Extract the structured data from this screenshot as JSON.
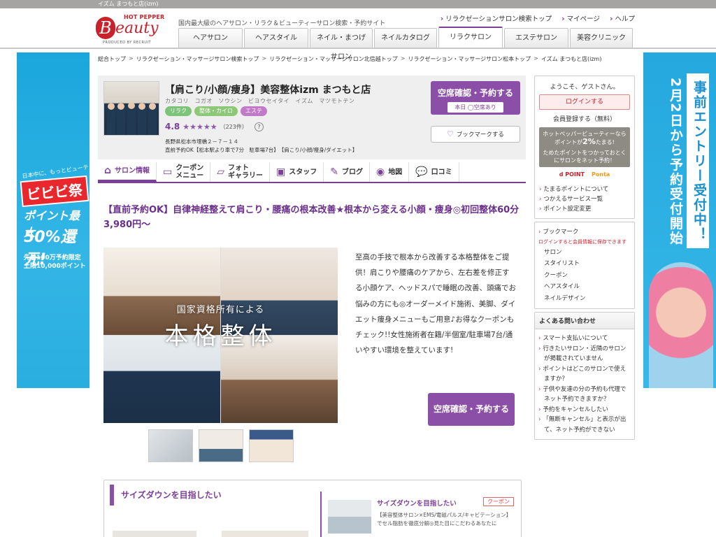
{
  "topbar": {
    "text": "イズム まつもと店(izm)"
  },
  "header": {
    "logo_hp": "HOT PEPPER",
    "logo_b": "B",
    "logo_beauty": "eauty",
    "logo_produced": "PRODUCED BY RECRUIT",
    "tagline": "国内最大級のヘアサロン・リラク＆ビューティーサロン検索・予約サイト",
    "links": [
      "リラクゼーションサロン検索トップ",
      "マイページ",
      "ヘルプ"
    ],
    "tabs": [
      "ヘアサロン",
      "ヘアスタイル",
      "ネイル・まつげサロン",
      "ネイルカタログ",
      "リラクサロン",
      "エステサロン",
      "美容クリニック"
    ]
  },
  "breadcrumb": [
    "総合トップ",
    "リラクゼーション・マッサージサロン検索トップ",
    "リラクゼーション・マッサージサロン北信越トップ",
    "リラクゼーション・マッサージサロン松本トップ",
    "イズム まつもと店(izm)"
  ],
  "salon": {
    "name": "【肩こり/小顔/痩身】美容整体izm まつもと店",
    "kana": "カタコリ　コガオ　ソウシン　ビヨウセイタイ　イズム　マツモトテン",
    "tags": [
      "リラク",
      "整体・カイロ",
      "エステ"
    ],
    "rating": "4.8",
    "stars": "★★★★★",
    "review_count": "（223件）",
    "help": "?",
    "address": "長野県松本市埋橋２－７－１４",
    "access": "直前予約OK【松本駅より車で7分　駐車場7台】　【肩こり/小顔/痩身/ダイエット】",
    "reserve_label": "空席確認・予約する",
    "availability": "本日 ◯空席あり",
    "bookmark_label": "ブックマークする"
  },
  "salon_tabs": [
    {
      "icon": "⌂",
      "label": "サロン情報"
    },
    {
      "icon": "▭",
      "label": "クーポン\nメニュー"
    },
    {
      "icon": "▱",
      "label": "フォト\nギャラリー"
    },
    {
      "icon": "▣",
      "label": "スタッフ"
    },
    {
      "icon": "✎",
      "label": "ブログ"
    },
    {
      "icon": "◉",
      "label": "地図"
    },
    {
      "icon": "💬",
      "label": "口コミ"
    }
  ],
  "catch": "【直前予約OK】自律神経整えて肩こり・腰痛の根本改善★根本から変える小顔・痩身◎初回整体60分3,980円～",
  "photo_overlay": {
    "line1": "国家資格所有による",
    "line2": "本格整体"
  },
  "description": "至高の手技で根本から改善する本格整体をご提供！肩こりや腰痛のケアから、左右差を修正する小顔ケア、ヘッドスパで睡眠の改善、頭痛でお悩みの方にも◎オーダーメイド施術、美脚、ダイエット痩身メニューもご用意♪お得なクーポンもチェック!!女性施術者在籍/半個室/駐車場7台/通いやすい環境を整えています!",
  "reserve2_label": "空席確認・予約する",
  "bottom": {
    "heading": "サイズダウンを目指したい",
    "item_title": "サイズダウンを目指したい",
    "coupon": "クーポン",
    "item_text": "【美容整体サロン×EMS/電磁パルス/キャビテーション】でセル脂肪を徹底分解◎見た目にこだわるあなたに"
  },
  "sidebar": {
    "welcome": "ようこそ、ゲストさん。",
    "login": "ログインする",
    "register": "会員登録する（無料）",
    "promo1": "ホットペッパービューティーなら",
    "promo2": "ポイントが",
    "promo_pct": "2%",
    "promo3": "たまる!",
    "promo4": "ためたポイントをつかっておとくにサロンをネット予約！",
    "dpoint": "d POINT",
    "ponta": "Ponta",
    "links": [
      "たまるポイントについて",
      "つかえるサービス一覧",
      "ポイント設定変更"
    ],
    "bookmark_head": "ブックマーク",
    "bookmark_note": "ログインすると会員情報に保存できます",
    "bookmark_items": [
      "サロン",
      "スタイリスト",
      "クーポン",
      "ヘアスタイル",
      "ネイルデザイン"
    ],
    "faq_head": "よくある問い合わせ",
    "faq": [
      "スマート支払いについて",
      "行きたいサロン・近隣のサロンが掲載されていません",
      "ポイントはどこのサロンで使えますか？",
      "子供や友達の分の予約も代理でネット予約できますか？",
      "予約をキャンセルしたい",
      "「無断キャンセル」と表示が出て、ネット予約ができない"
    ]
  },
  "ads": {
    "left_small": "日本中に、もっとビューティーを。",
    "left_title": "ビビビ祭",
    "left_pt": "ポイント最大",
    "left_pct": "50%還元!",
    "left_lim": "先着100万予約限定\n上限10,000ポイント",
    "right_a": "事前エントリー受付中！",
    "right_b": "2月2日から予約受付開始"
  },
  "colors": {
    "brand_purple": "#7b3f98",
    "button_purple": "#8b4fa8",
    "logo_red": "#c8222c"
  }
}
